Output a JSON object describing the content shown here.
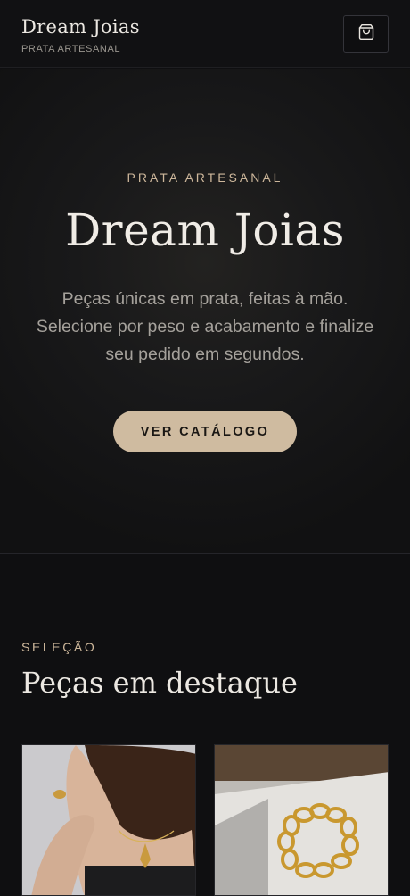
{
  "header": {
    "brand": "Dream Joias",
    "tagline": "PRATA ARTESANAL",
    "cart_icon": "shopping-bag-icon"
  },
  "hero": {
    "eyebrow": "PRATA ARTESANAL",
    "title": "Dream Joias",
    "description": "Peças únicas em prata, feitas à mão. Selecione por peso e acabamento e finalize seu pedido em segundos.",
    "cta_label": "VER CATÁLOGO"
  },
  "featured": {
    "eyebrow": "SELEÇÃO",
    "title": "Peças em destaque"
  },
  "colors": {
    "accent": "#cfbba0",
    "background": "#0f0f11",
    "text": "#ece8e2"
  }
}
